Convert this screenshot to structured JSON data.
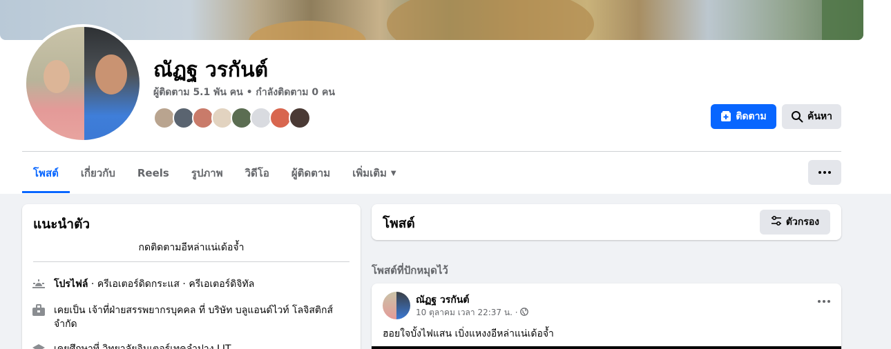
{
  "profile": {
    "name": "ณัฏฐ วรกันต์",
    "follow_stats": "ผู้ติดตาม 5.1 พัน คน • กำลังติดตาม 0 คน",
    "friend_avatar_colors": [
      "#b9a48f",
      "#5a6470",
      "#c97b6a",
      "#e2d3c0",
      "#5b6d52",
      "#d9dbe0",
      "#d8664f",
      "#4a3a35"
    ]
  },
  "actions": {
    "follow_label": "ติดตาม",
    "search_label": "ค้นหา",
    "follow_color": "#0866ff"
  },
  "tabs": [
    {
      "label": "โพสต์",
      "active": true
    },
    {
      "label": "เกี่ยวกับ"
    },
    {
      "label": "Reels"
    },
    {
      "label": "รูปภาพ"
    },
    {
      "label": "วิดีโอ"
    },
    {
      "label": "ผู้ติดตาม"
    },
    {
      "label": "เพิ่มเติม"
    }
  ],
  "intro": {
    "title": "แนะนำตัว",
    "bio": "กดติดตามอีหล่าแน่เด้อจ้ำ",
    "profile_label": "โปรไฟล์",
    "profile_text": " · ครีเอเตอร์ดิจิทัล",
    "profile_text_full": "· ครีเอเตอร์ดิดกระแส · ครีเอเตอร์ดิจิทัล",
    "work_text": "เคยเป็น เจ้าที่ฝ่ายสรรพยากรบุคคล ที่ บริษัท บลูแอนด์ไวท์ โลจิสติกส์ จำกัด",
    "edu_text": "เคยศึกษาที่ วิทยาลัยอินเตอร์เทคลำปาง LIT"
  },
  "posts": {
    "title": "โพสต์",
    "filter_label": "ตัวกรอง",
    "pinned_label": "โพสต์ที่ปักหมุดไว้",
    "pinned_post": {
      "author": "ณัฏฐ วรกันต์",
      "timestamp": "10 ตุลาคม เวลา 22:37 น. ·",
      "text": "ฮอยใจบั้งไฟแสน   เบิ่งแหงงอีหล่าแน่เด้อจ้ำ"
    }
  }
}
